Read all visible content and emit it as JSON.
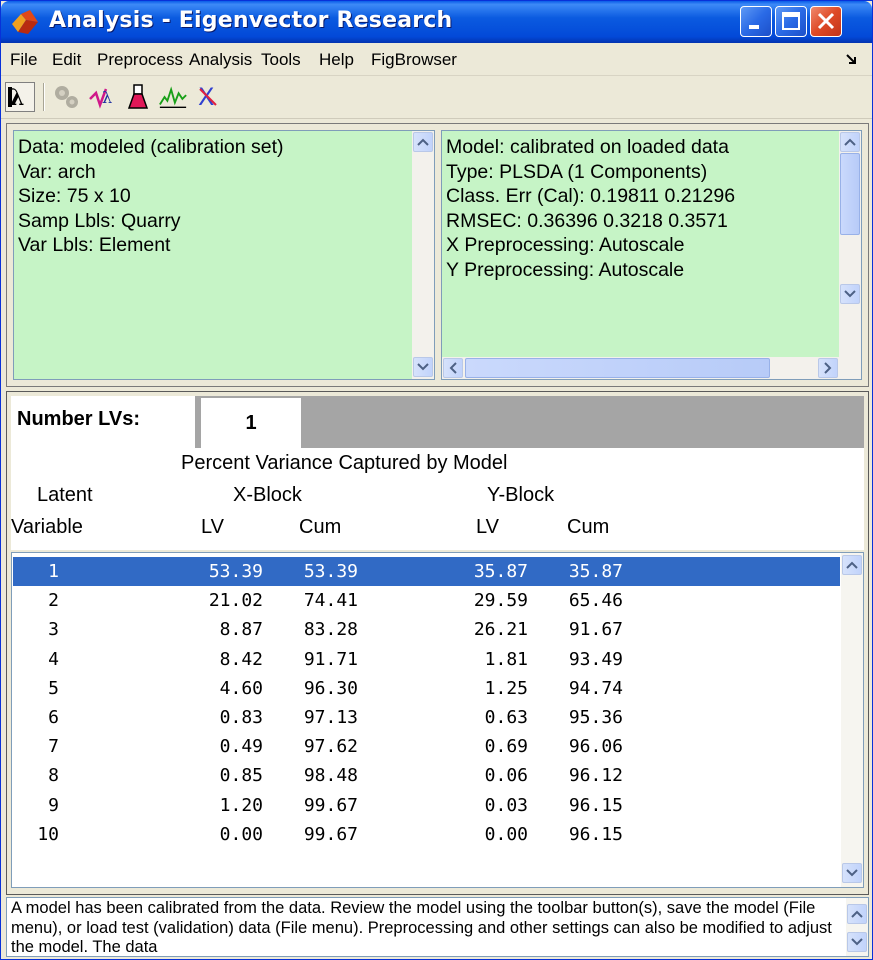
{
  "window": {
    "title": "Analysis - Eigenvector Research"
  },
  "menu": {
    "items": [
      "File",
      "Edit",
      "Preprocess",
      "Analysis",
      "Tools",
      "Help",
      "FigBrowser"
    ],
    "corner_icon": "resize-arrow-icon"
  },
  "toolbar": {
    "icons": [
      "lambda-icon",
      "gears-icon",
      "loadings-icon",
      "flask-icon",
      "spectra-icon",
      "close-x-icon"
    ]
  },
  "data_info": {
    "lines": [
      "Data: modeled (calibration set)",
      "Var: arch",
      "Size: 75 x 10",
      "Samp Lbls: Quarry",
      "Var Lbls: Element"
    ]
  },
  "model_info": {
    "lines": [
      "Model: calibrated on loaded data",
      "Type: PLSDA (1 Components)",
      "Class. Err (Cal): 0.19811 0.21296",
      "RMSEC: 0.36396  0.3218 0.3571",
      "X Preprocessing: Autoscale",
      "Y Preprocessing: Autoscale"
    ]
  },
  "lv_selector": {
    "label": "Number LVs:",
    "value": "1"
  },
  "variance_table": {
    "title": "Percent Variance Captured by Model",
    "col_latent_1": "Latent",
    "col_latent_2": "Variable",
    "group_x": "X-Block",
    "group_y": "Y-Block",
    "sub_lv": "LV",
    "sub_cum": "Cum",
    "rows": [
      [
        "1",
        "53.39",
        "53.39",
        "35.87",
        "35.87"
      ],
      [
        "2",
        "21.02",
        "74.41",
        "29.59",
        "65.46"
      ],
      [
        "3",
        "8.87",
        "83.28",
        "26.21",
        "91.67"
      ],
      [
        "4",
        "8.42",
        "91.71",
        "1.81",
        "93.49"
      ],
      [
        "5",
        "4.60",
        "96.30",
        "1.25",
        "94.74"
      ],
      [
        "6",
        "0.83",
        "97.13",
        "0.63",
        "95.36"
      ],
      [
        "7",
        "0.49",
        "97.62",
        "0.69",
        "96.06"
      ],
      [
        "8",
        "0.85",
        "98.48",
        "0.06",
        "96.12"
      ],
      [
        "9",
        "1.20",
        "99.67",
        "0.03",
        "96.15"
      ],
      [
        "10",
        "0.00",
        "99.67",
        "0.00",
        "96.15"
      ]
    ],
    "selected_row": 0
  },
  "status": {
    "text": "A model has been calibrated from the data. Review the model using the toolbar button(s), save the model (File menu), or load test (validation) data (File menu). Preprocessing and other settings can also be modified to adjust the model. The data"
  },
  "colors": {
    "titlebar": "#0a5ce8",
    "info_panel_bg": "#c6f4c6",
    "selection": "#316ac5",
    "window_bg": "#ece9d8"
  }
}
